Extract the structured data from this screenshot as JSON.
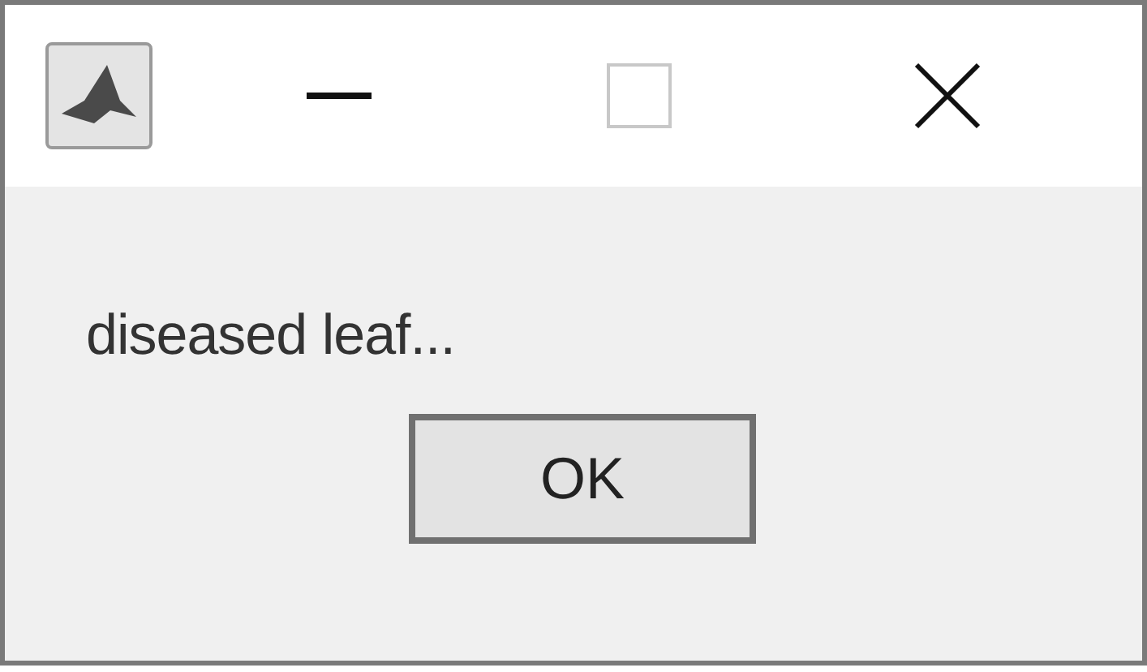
{
  "window": {
    "controls": [
      {
        "kind": "minimize",
        "disabled": false
      },
      {
        "kind": "maximize",
        "disabled": true
      },
      {
        "kind": "close",
        "disabled": false
      }
    ]
  },
  "message": "diseased leaf...",
  "buttons": [
    {
      "label": "OK",
      "selected": true
    }
  ]
}
